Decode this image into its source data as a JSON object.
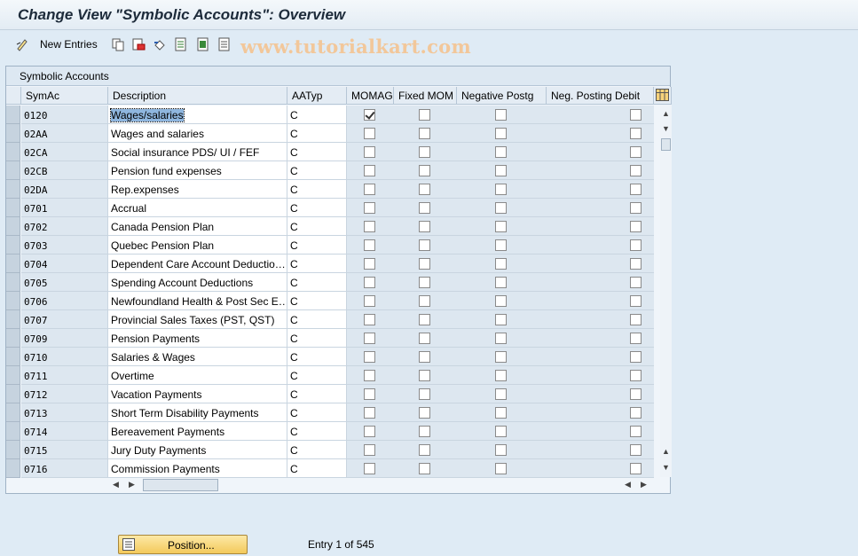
{
  "window": {
    "title": "Change View \"Symbolic Accounts\": Overview"
  },
  "toolbar": {
    "new_entries_label": "New Entries",
    "watermark": "www.tutorialkart.com",
    "icons": [
      "edit-pencil-icon",
      "copy-icon",
      "delete-icon",
      "undo-icon",
      "select-all-icon",
      "select-block-icon",
      "deselect-all-icon"
    ]
  },
  "table": {
    "title": "Symbolic Accounts",
    "columns": [
      "SymAc",
      "Description",
      "AATyp",
      "MOMAG",
      "Fixed MOM",
      "Negative Postg",
      "Neg. Posting Debit"
    ],
    "rows": [
      {
        "symac": "0120",
        "description": "Wages/salaries",
        "aatyp": "C",
        "momag": true
      },
      {
        "symac": "02AA",
        "description": "Wages and salaries",
        "aatyp": "C",
        "momag": false
      },
      {
        "symac": "02CA",
        "description": "Social insurance PDS/ UI / FEF",
        "aatyp": "C",
        "momag": false
      },
      {
        "symac": "02CB",
        "description": "Pension fund expenses",
        "aatyp": "C",
        "momag": false
      },
      {
        "symac": "02DA",
        "description": "Rep.expenses",
        "aatyp": "C",
        "momag": false
      },
      {
        "symac": "0701",
        "description": "Accrual",
        "aatyp": "C",
        "momag": false
      },
      {
        "symac": "0702",
        "description": "Canada Pension Plan",
        "aatyp": "C",
        "momag": false
      },
      {
        "symac": "0703",
        "description": "Quebec Pension Plan",
        "aatyp": "C",
        "momag": false
      },
      {
        "symac": "0704",
        "description": "Dependent Care Account Deductio…",
        "aatyp": "C",
        "momag": false
      },
      {
        "symac": "0705",
        "description": "Spending Account Deductions",
        "aatyp": "C",
        "momag": false
      },
      {
        "symac": "0706",
        "description": "Newfoundland Health & Post Sec E…",
        "aatyp": "C",
        "momag": false
      },
      {
        "symac": "0707",
        "description": "Provincial Sales Taxes (PST, QST)",
        "aatyp": "C",
        "momag": false
      },
      {
        "symac": "0709",
        "description": "Pension Payments",
        "aatyp": "C",
        "momag": false
      },
      {
        "symac": "0710",
        "description": "Salaries & Wages",
        "aatyp": "C",
        "momag": false
      },
      {
        "symac": "0711",
        "description": "Overtime",
        "aatyp": "C",
        "momag": false
      },
      {
        "symac": "0712",
        "description": "Vacation Payments",
        "aatyp": "C",
        "momag": false
      },
      {
        "symac": "0713",
        "description": "Short Term Disability Payments",
        "aatyp": "C",
        "momag": false
      },
      {
        "symac": "0714",
        "description": "Bereavement Payments",
        "aatyp": "C",
        "momag": false
      },
      {
        "symac": "0715",
        "description": "Jury Duty Payments",
        "aatyp": "C",
        "momag": false
      },
      {
        "symac": "0716",
        "description": "Commission Payments",
        "aatyp": "C",
        "momag": false
      }
    ]
  },
  "footer": {
    "position_label": "Position...",
    "entry_text": "Entry 1 of 545"
  },
  "colors": {
    "header_bg": "#e4ecf4",
    "selection": "#8fb6de",
    "button": "#f3c95b"
  }
}
